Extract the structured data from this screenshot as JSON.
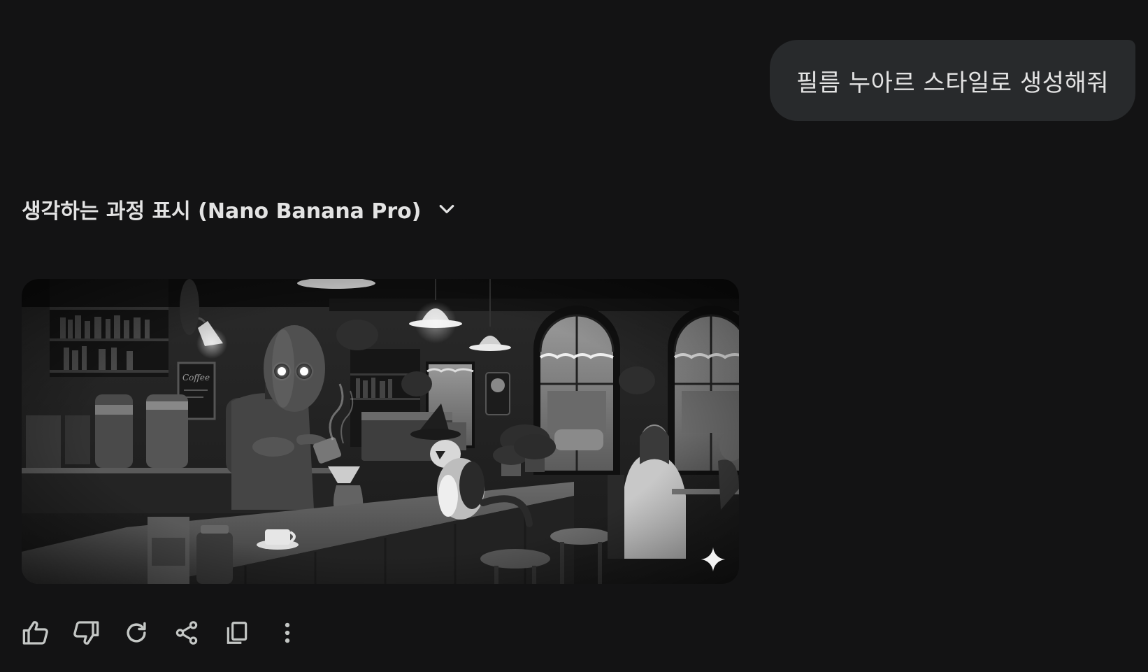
{
  "user_message": {
    "text": "필름 누아르 스타일로 생성해줘"
  },
  "response": {
    "thoughts_toggle_label": "생각하는 과정 표시 (Nano Banana Pro)",
    "toggle_icon": "chevron-down-icon",
    "image": {
      "badge_icon": "sparkle-icon"
    }
  },
  "actions": {
    "icons": [
      "thumbs-up-icon",
      "thumbs-down-icon",
      "redo-icon",
      "share-icon",
      "copy-icon",
      "more-vert-icon"
    ]
  },
  "colors": {
    "background": "#131314",
    "bubble": "#282a2c",
    "text": "#e3e3e3"
  }
}
